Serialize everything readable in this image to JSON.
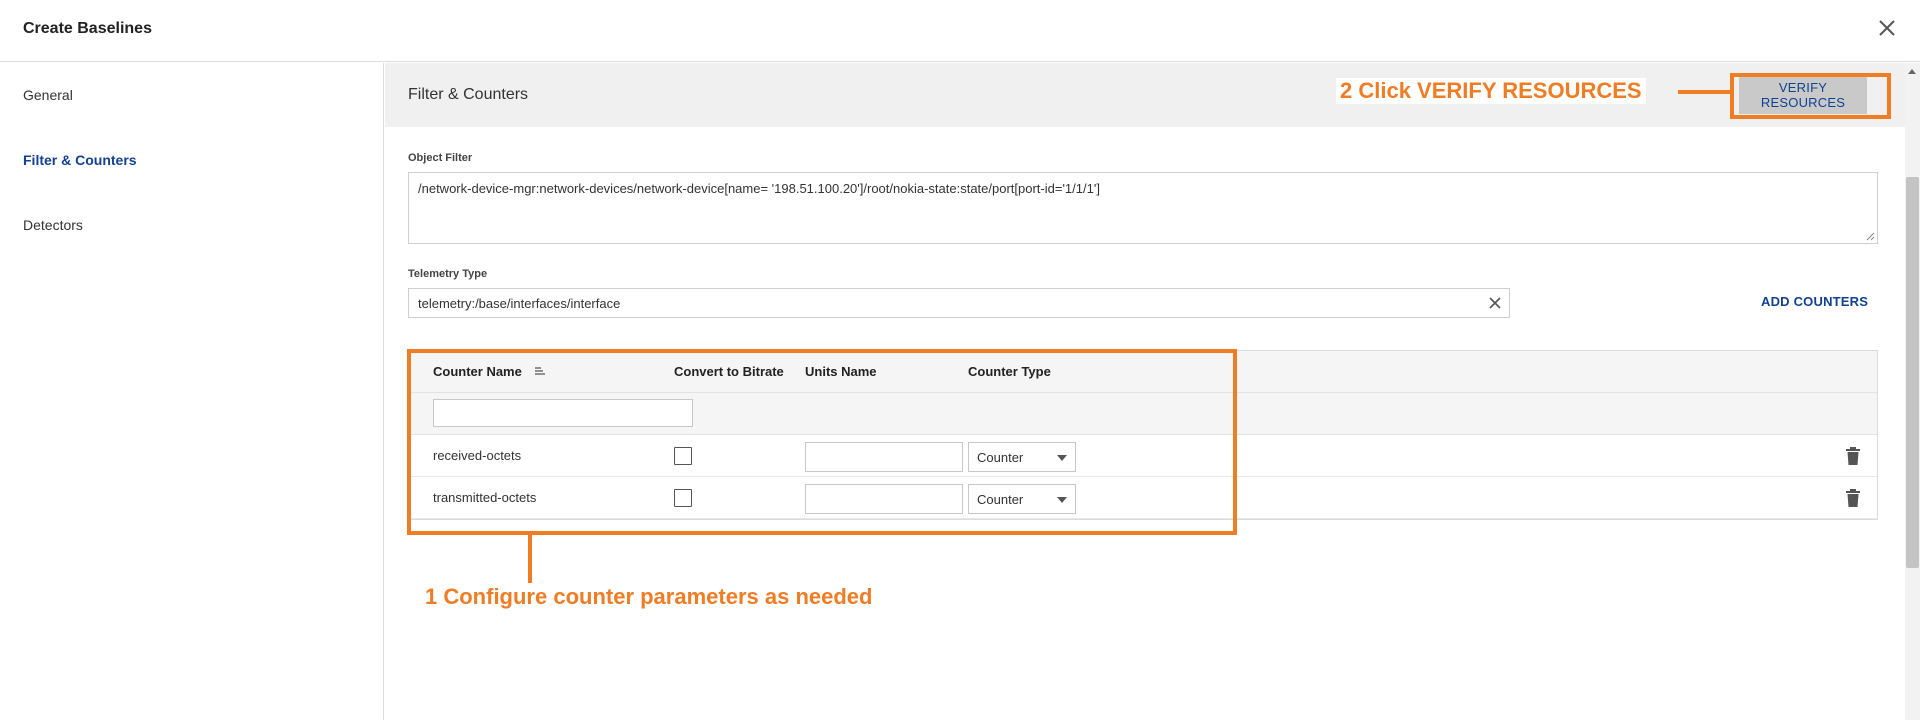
{
  "dialog": {
    "title": "Create Baselines"
  },
  "sidebar": {
    "items": [
      {
        "label": "General"
      },
      {
        "label": "Filter & Counters",
        "active": true
      },
      {
        "label": "Detectors"
      }
    ]
  },
  "section": {
    "title": "Filter & Counters",
    "verify_label": "VERIFY RESOURCES"
  },
  "object_filter": {
    "label": "Object Filter",
    "value": "/network-device-mgr:network-devices/network-device[name= '198.51.100.20']/root/nokia-state:state/port[port-id='1/1/1']"
  },
  "telemetry": {
    "label": "Telemetry Type",
    "value": "telemetry:/base/interfaces/interface",
    "add_counters_label": "ADD COUNTERS"
  },
  "table": {
    "headers": {
      "counter_name": "Counter Name",
      "convert": "Convert to Bitrate",
      "units": "Units Name",
      "type": "Counter Type"
    },
    "filter_value": "",
    "rows": [
      {
        "counter_name": "received-octets",
        "convert": false,
        "units": "",
        "type": "Counter"
      },
      {
        "counter_name": "transmitted-octets",
        "convert": false,
        "units": "",
        "type": "Counter"
      }
    ]
  },
  "annotations": {
    "step1": "1 Configure counter parameters as needed",
    "step2": "2 Click VERIFY RESOURCES",
    "color": "#f07c24"
  },
  "colors": {
    "accent": "#124191",
    "annotation": "#f07c24"
  }
}
